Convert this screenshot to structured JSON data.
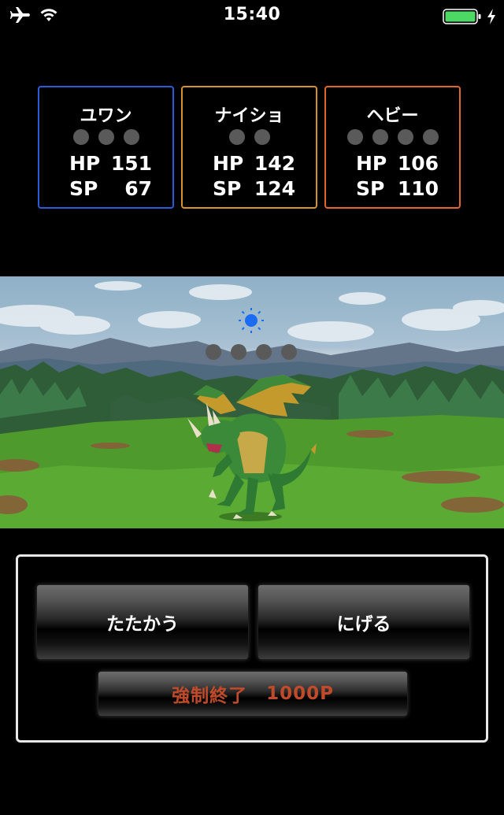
{
  "status_bar": {
    "time": "15:40",
    "icons": [
      "airplane-icon",
      "wifi-icon",
      "battery-icon",
      "charging-icon"
    ],
    "battery_color": "#4cd964"
  },
  "party": [
    {
      "name": "ユワン",
      "dots": 3,
      "hp_label": "HP",
      "hp": "151",
      "sp_label": "SP",
      "sp": "67",
      "border": "#2a5cd8"
    },
    {
      "name": "ナイショ",
      "dots": 2,
      "hp_label": "HP",
      "hp": "142",
      "sp_label": "SP",
      "sp": "124",
      "border": "#d8922a"
    },
    {
      "name": "ヘビー",
      "dots": 4,
      "hp_label": "HP",
      "hp": "106",
      "sp_label": "SP",
      "sp": "110",
      "border": "#e0672a"
    }
  ],
  "enemy": {
    "name_icon": "dragon-icon",
    "dots": 4,
    "status_icon": "sun-icon",
    "status_color": "#1a6cf5"
  },
  "commands": {
    "fight": "たたかう",
    "flee": "にげる",
    "force_quit_label": "強制終了",
    "force_quit_cost": "1000P",
    "force_quit_color": "#c04a2a"
  }
}
